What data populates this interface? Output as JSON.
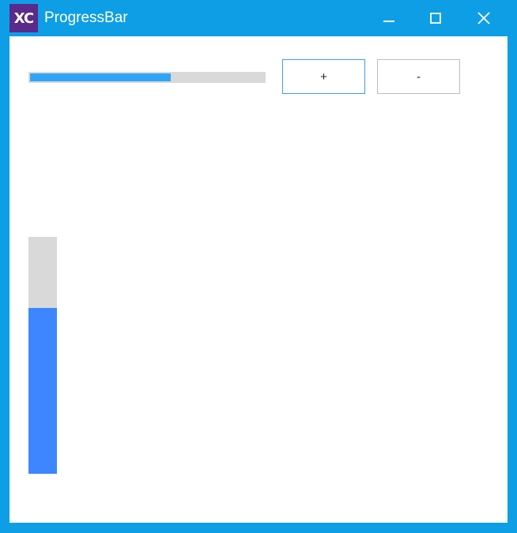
{
  "window": {
    "title": "ProgressBar",
    "logo_text": "XC",
    "accent_color": "#0e9ee6",
    "logo_color": "#5a2a8c",
    "controls": {
      "minimize_icon": "minimize-icon",
      "maximize_icon": "maximize-icon",
      "close_icon": "close-icon"
    }
  },
  "horizontal_progress": {
    "value_percent": 60,
    "fill_color": "#2fa5f5",
    "track_color": "#d9d9d9"
  },
  "buttons": {
    "increase_label": "+",
    "decrease_label": "-"
  },
  "vertical_progress": {
    "value_percent": 70,
    "fill_color": "#3d86ff",
    "track_color": "#d9d9d9"
  }
}
